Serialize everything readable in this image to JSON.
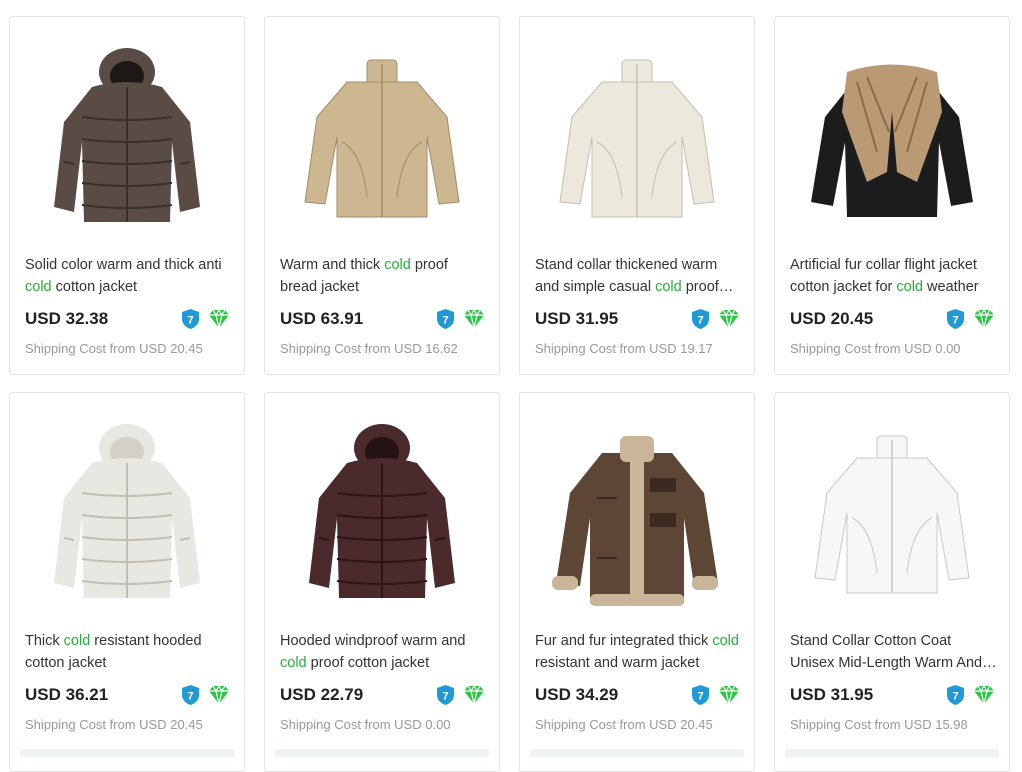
{
  "accent_color": "#27ae3a",
  "products": [
    {
      "image": "puffer-jacket-dark-brown",
      "title_parts": [
        {
          "text": "Solid color warm and thick anti ",
          "highlight": false
        },
        {
          "text": "cold",
          "highlight": true
        },
        {
          "text": " cotton jacket",
          "highlight": false
        }
      ],
      "price": "USD 32.38",
      "shipping": "Shipping Cost from USD 20.45"
    },
    {
      "image": "bomber-jacket-khaki",
      "title_parts": [
        {
          "text": "Warm and thick ",
          "highlight": false
        },
        {
          "text": "cold",
          "highlight": true
        },
        {
          "text": " proof bread jacket",
          "highlight": false
        }
      ],
      "price": "USD 63.91",
      "shipping": "Shipping Cost from USD 16.62"
    },
    {
      "image": "stand-collar-jacket-cream",
      "title_parts": [
        {
          "text": "Stand collar thickened warm and simple casual ",
          "highlight": false
        },
        {
          "text": "cold",
          "highlight": true
        },
        {
          "text": " proof cotton jacket",
          "highlight": false
        }
      ],
      "price": "USD 31.95",
      "shipping": "Shipping Cost from USD 19.17"
    },
    {
      "image": "fur-collar-flight-jacket-black",
      "title_parts": [
        {
          "text": "Artificial fur collar flight jacket cotton jacket for ",
          "highlight": false
        },
        {
          "text": "cold",
          "highlight": true
        },
        {
          "text": " weather",
          "highlight": false
        }
      ],
      "price": "USD 20.45",
      "shipping": "Shipping Cost from USD 0.00"
    },
    {
      "image": "hooded-puffer-jacket-white",
      "title_parts": [
        {
          "text": "Thick ",
          "highlight": false
        },
        {
          "text": "cold",
          "highlight": true
        },
        {
          "text": " resistant hooded cotton jacket",
          "highlight": false
        }
      ],
      "price": "USD 36.21",
      "shipping": "Shipping Cost from USD 20.45"
    },
    {
      "image": "hooded-puffer-jacket-burgundy",
      "title_parts": [
        {
          "text": "Hooded windproof warm and ",
          "highlight": false
        },
        {
          "text": "cold",
          "highlight": true
        },
        {
          "text": " proof cotton jacket",
          "highlight": false
        }
      ],
      "price": "USD 22.79",
      "shipping": "Shipping Cost from USD 0.00"
    },
    {
      "image": "fur-lined-jacket-brown",
      "title_parts": [
        {
          "text": "Fur and fur integrated thick ",
          "highlight": false
        },
        {
          "text": "cold",
          "highlight": true
        },
        {
          "text": " resistant and warm jacket",
          "highlight": false
        }
      ],
      "price": "USD 34.29",
      "shipping": "Shipping Cost from USD 20.45"
    },
    {
      "image": "stand-collar-coat-white",
      "title_parts": [
        {
          "text": "Stand Collar Cotton Coat Unisex Mid-Length Warm And Cold Proof Coat",
          "highlight": false
        }
      ],
      "price": "USD 31.95",
      "shipping": "Shipping Cost from USD 15.98"
    }
  ],
  "badges": {
    "delivery_badge_text": "7",
    "delivery_badge_color": "#1f9ad6",
    "gem_badge_color": "#2fc347"
  }
}
